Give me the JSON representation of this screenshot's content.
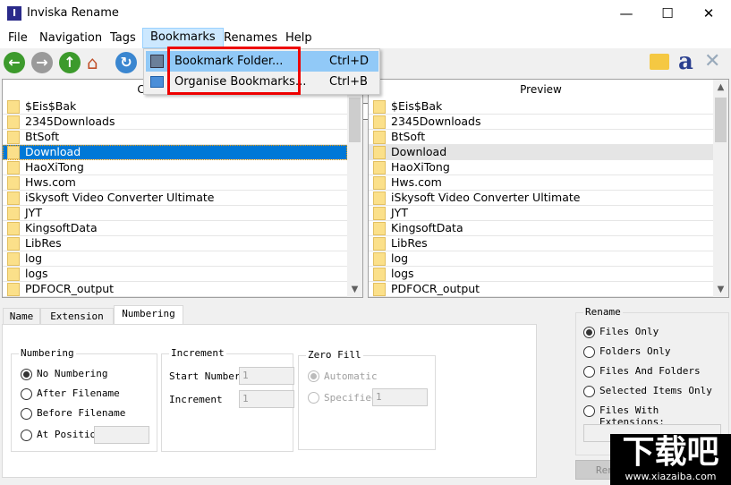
{
  "window": {
    "title": "Inviska Rename",
    "app_icon": "I",
    "minimize": "—",
    "maximize": "☐",
    "close": "✕"
  },
  "menubar": {
    "items": [
      "File",
      "Navigation",
      "Tags",
      "Bookmarks",
      "Renames",
      "Help"
    ]
  },
  "bookmarks_menu": {
    "items": [
      {
        "label": "Bookmark Folder...",
        "shortcut": "Ctrl+D",
        "icon": "floppy-disk-icon"
      },
      {
        "label": "Organise Bookmarks...",
        "shortcut": "Ctrl+B",
        "icon": "folder-icon"
      }
    ]
  },
  "toolbar": {
    "path": ""
  },
  "left_pane": {
    "header": "Current Name",
    "rows": [
      "$Eis$Bak",
      "2345Downloads",
      "BtSoft",
      "Download",
      "HaoXiTong",
      "Hws.com",
      "iSkysoft Video Converter Ultimate",
      "JYT",
      "KingsoftData",
      "LibRes",
      "log",
      "logs",
      "PDFOCR_output"
    ],
    "selected": "Download"
  },
  "right_pane": {
    "header": "Preview",
    "rows": [
      "$Eis$Bak",
      "2345Downloads",
      "BtSoft",
      "Download",
      "HaoXiTong",
      "Hws.com",
      "iSkysoft Video Converter Ultimate",
      "JYT",
      "KingsoftData",
      "LibRes",
      "log",
      "logs",
      "PDFOCR_output"
    ]
  },
  "tabs": [
    "Name",
    "Extension",
    "Numbering"
  ],
  "numbering": {
    "title": "Numbering",
    "options": [
      "No Numbering",
      "After Filename",
      "Before Filename",
      "At Position"
    ],
    "selected": "No Numbering",
    "position_value": ""
  },
  "increment": {
    "title": "Increment",
    "start_label": "Start Number",
    "start_value": "1",
    "inc_label": "Increment",
    "inc_value": "1"
  },
  "zero_fill": {
    "title": "Zero Fill",
    "options": [
      "Automatic",
      "Specified"
    ],
    "selected": "Automatic",
    "specified_value": "1"
  },
  "rename": {
    "title": "Rename",
    "options": [
      "Files Only",
      "Folders Only",
      "Files And Folders",
      "Selected Items Only",
      "Files With Extensions:"
    ],
    "selected": "Files Only",
    "extensions_value": "",
    "button": "Rename"
  },
  "watermark": {
    "text": "下载吧",
    "url": "www.xiazaiba.com"
  }
}
